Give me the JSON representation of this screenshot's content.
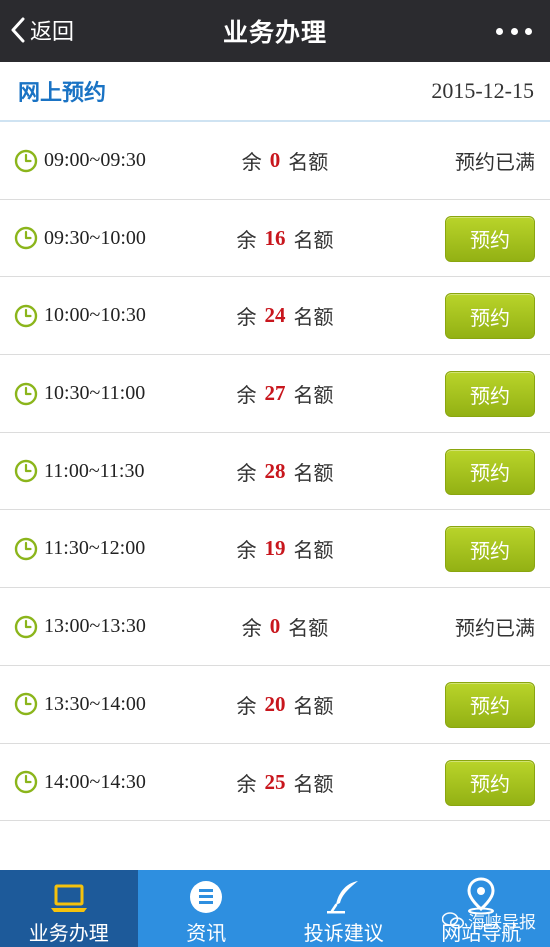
{
  "topbar": {
    "back_label": "返回",
    "title": "业务办理"
  },
  "section": {
    "title": "网上预约",
    "date": "2015-12-15"
  },
  "quota_prefix": "余",
  "quota_suffix": "名额",
  "slots": [
    {
      "time": "09:00~09:30",
      "remaining": "0",
      "action": "预约已满",
      "full": true
    },
    {
      "time": "09:30~10:00",
      "remaining": "16",
      "action": "预约",
      "full": false
    },
    {
      "time": "10:00~10:30",
      "remaining": "24",
      "action": "预约",
      "full": false
    },
    {
      "time": "10:30~11:00",
      "remaining": "27",
      "action": "预约",
      "full": false
    },
    {
      "time": "11:00~11:30",
      "remaining": "28",
      "action": "预约",
      "full": false
    },
    {
      "time": "11:30~12:00",
      "remaining": "19",
      "action": "预约",
      "full": false
    },
    {
      "time": "13:00~13:30",
      "remaining": "0",
      "action": "预约已满",
      "full": true
    },
    {
      "time": "13:30~14:00",
      "remaining": "20",
      "action": "预约",
      "full": false
    },
    {
      "time": "14:00~14:30",
      "remaining": "25",
      "action": "预约",
      "full": false
    }
  ],
  "tabs": [
    {
      "label": "业务办理",
      "icon": "laptop-icon",
      "active": true
    },
    {
      "label": "资讯",
      "icon": "news-icon",
      "active": false
    },
    {
      "label": "投诉建议",
      "icon": "feather-icon",
      "active": false
    },
    {
      "label": "网站导航",
      "icon": "location-pin-icon",
      "active": false
    }
  ],
  "watermark": "海峡导报",
  "colors": {
    "topbar": "#2b2b2f",
    "accent_blue": "#1a73c4",
    "quota_red": "#c8161d",
    "button_green": "#a6c21f",
    "tabbar": "#2e8fe0",
    "tab_active": "#1d5a9a"
  }
}
